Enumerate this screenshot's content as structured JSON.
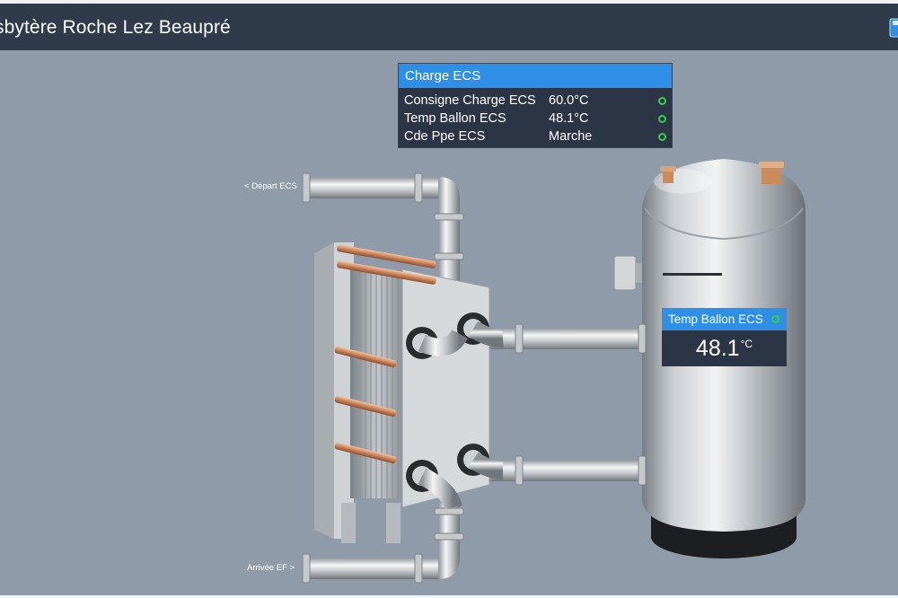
{
  "header": {
    "title": "sbytère Roche Lez Beaupré"
  },
  "charge_panel": {
    "title": "Charge ECS",
    "rows": [
      {
        "label": "Consigne Charge ECS",
        "value": "60.0°C",
        "status_color": "#31d24a"
      },
      {
        "label": "Temp Ballon ECS",
        "value": "48.1°C",
        "status_color": "#31d24a"
      },
      {
        "label": "Cde Ppe ECS",
        "value": "Marche",
        "status_color": "#31d24a"
      }
    ]
  },
  "tank_tile": {
    "title": "Temp Ballon ECS",
    "value": "48.1",
    "unit": "°C",
    "status_color": "#31d24a"
  },
  "pipes": {
    "depart_label": "< Départ ECS",
    "arrivee_label": "Arrivée EF >"
  },
  "colors": {
    "accent": "#2f8ee6",
    "header_bg": "#2f3a4b",
    "panel_bg": "#2c3545",
    "canvas_bg": "#8f9ba8",
    "status_ok": "#31d24a"
  }
}
